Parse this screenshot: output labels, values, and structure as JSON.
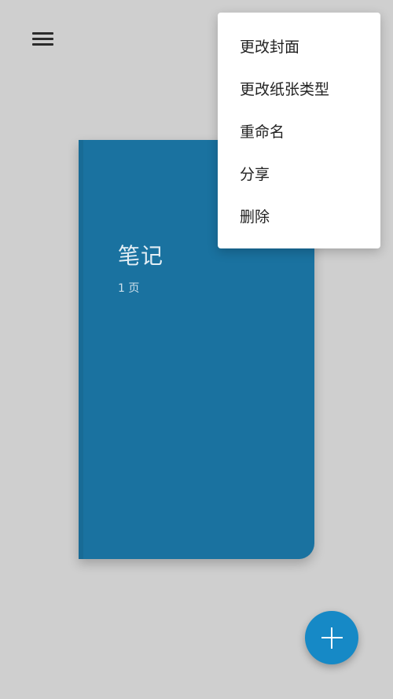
{
  "header": {
    "menu_icon": "hamburger-menu-icon"
  },
  "notebook": {
    "title": "笔记",
    "pages": "1 页",
    "cover_color": "#1a72a0"
  },
  "context_menu": {
    "items": [
      {
        "label": "更改封面"
      },
      {
        "label": "更改纸张类型"
      },
      {
        "label": "重命名"
      },
      {
        "label": "分享"
      },
      {
        "label": "删除"
      }
    ]
  },
  "fab": {
    "icon": "plus-icon",
    "color": "#1689c6"
  }
}
